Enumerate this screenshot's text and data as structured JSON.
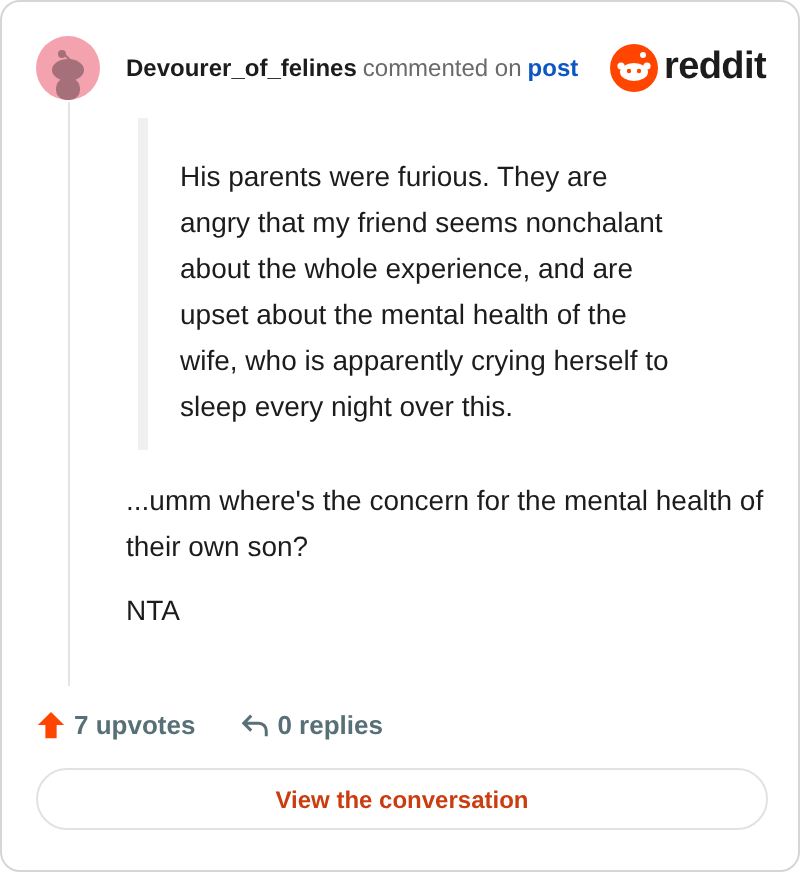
{
  "header": {
    "username": "Devourer_of_felines",
    "action": "commented on",
    "link": "post",
    "brand": "reddit"
  },
  "quote": "His parents were furious. They are angry that my friend seems nonchalant about the whole experience, and are upset about the mental health of the wife, who is apparently crying herself to sleep every night over this.",
  "paragraphs": [
    "...umm where's the concern for the mental health of their own son?",
    "NTA"
  ],
  "footer": {
    "upvotes": "7 upvotes",
    "replies": "0 replies"
  },
  "button": "View the conversation"
}
